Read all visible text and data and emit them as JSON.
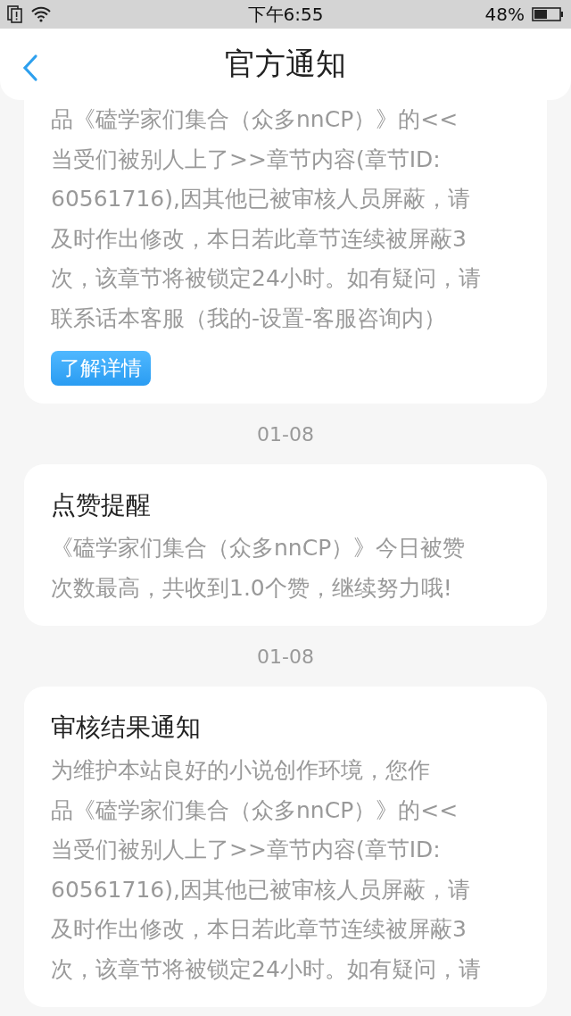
{
  "status_bar": {
    "time": "下午6:55",
    "battery": "48%"
  },
  "header": {
    "title": "官方通知"
  },
  "feed": [
    {
      "kind": "card",
      "lines": [
        "品《磕学家们集合（众多nnCP）》的<<",
        "当受们被别人上了>>章节内容(章节ID:",
        "60561716),因其他已被审核人员屏蔽，请",
        "及时作出修改，本日若此章节连续被屏蔽3",
        "次，该章节将被锁定24小时。如有疑问，请",
        "联系话本客服（我的-设置-客服咨询内）"
      ],
      "button": "了解详情"
    },
    {
      "kind": "date",
      "text": "01-08"
    },
    {
      "kind": "card",
      "title": "点赞提醒",
      "lines": [
        "《磕学家们集合（众多nnCP）》今日被赞",
        "次数最高，共收到1.0个赞，继续努力哦!"
      ]
    },
    {
      "kind": "date",
      "text": "01-08"
    },
    {
      "kind": "card",
      "title": "审核结果通知",
      "lines": [
        "为维护本站良好的小说创作环境，您作",
        "品《磕学家们集合（众多nnCP）》的<<",
        "当受们被别人上了>>章节内容(章节ID:",
        "60561716),因其他已被审核人员屏蔽，请",
        "及时作出修改，本日若此章节连续被屏蔽3",
        "次，该章节将被锁定24小时。如有疑问，请"
      ]
    }
  ]
}
